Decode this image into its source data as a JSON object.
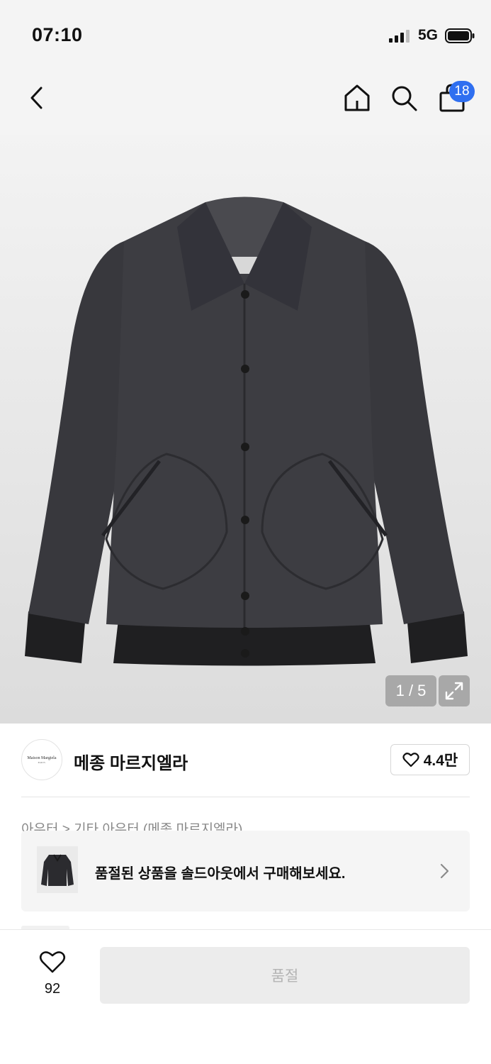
{
  "status_bar": {
    "time": "07:10",
    "network": "5G",
    "icons": [
      "signal-icon",
      "battery-icon"
    ]
  },
  "nav": {
    "icons": [
      "back-arrow-icon",
      "home-icon",
      "search-icon",
      "shopping-bag-icon"
    ],
    "cart_badge": "18",
    "accent_color": "#2f6ff0"
  },
  "gallery": {
    "counter": "1 / 5",
    "expand_icon": "expand-icon"
  },
  "brand": {
    "logo_text": "Maison Margiela",
    "logo_sub": "PARIS",
    "name": "메종 마르지엘라",
    "like_count": "4.4만"
  },
  "breadcrumb": "아우터 > 기타 아우터 (메종 마르지엘라)",
  "soldout_banner": {
    "text": "품절된 상품을 솔드아웃에서 구매해보세요."
  },
  "bottom": {
    "wish_count": "92",
    "buy_label": "품절"
  }
}
